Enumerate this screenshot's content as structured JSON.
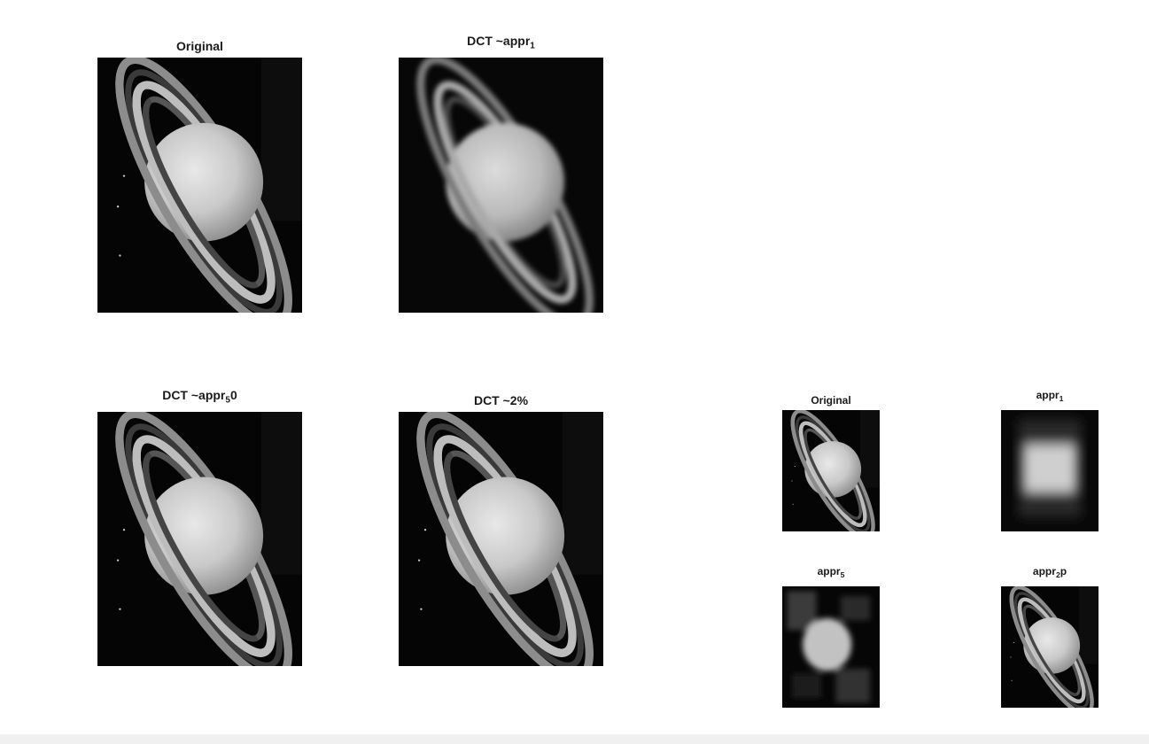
{
  "figure": {
    "panels": [
      {
        "id": "p1",
        "title": "Original",
        "sub": "",
        "after": "",
        "variant": "sharp"
      },
      {
        "id": "p2",
        "title": "DCT ~appr",
        "sub": "1",
        "after": "",
        "variant": "soft"
      },
      {
        "id": "p3",
        "title": "DCT ~appr",
        "sub": "5",
        "after": "0",
        "variant": "sharp"
      },
      {
        "id": "p4",
        "title": "DCT ~2%",
        "sub": "",
        "after": "",
        "variant": "sharp"
      },
      {
        "id": "p5",
        "title": "Original",
        "sub": "",
        "after": "",
        "variant": "sharp"
      },
      {
        "id": "p6",
        "title": "appr",
        "sub": "1",
        "after": "",
        "variant": "blob"
      },
      {
        "id": "p7",
        "title": "appr",
        "sub": "5",
        "after": "",
        "variant": "blocky"
      },
      {
        "id": "p8",
        "title": "appr",
        "sub": "2",
        "after": "p",
        "variant": "sharp"
      }
    ]
  },
  "colors": {
    "background": "#ffffff",
    "image_bg": "#050505",
    "title": "#1a1a1a",
    "footer": "#f0f0f0"
  }
}
